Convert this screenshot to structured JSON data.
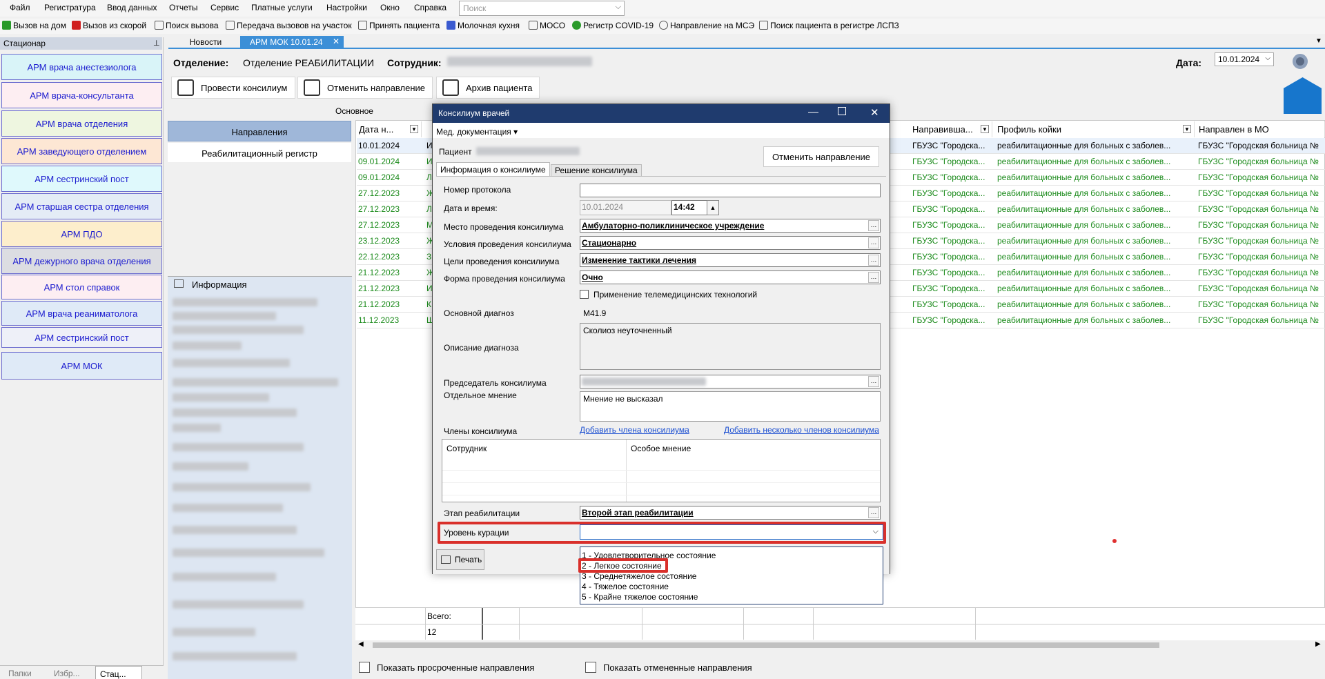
{
  "menu": [
    "Файл",
    "Регистратура",
    "Ввод данных",
    "Отчеты",
    "Сервис",
    "Платные услуги",
    "Настройки",
    "Окно",
    "Справка"
  ],
  "search": {
    "placeholder": "Поиск"
  },
  "toolbar": [
    "Вызов на дом",
    "Вызов из скорой",
    "Поиск вызова",
    "Передача вызовов на участок",
    "Принять пациента",
    "Молочная кухня",
    "МОСО",
    "Регистр COVID-19",
    "Направление на МСЭ",
    "Поиск пациента в регистре ЛСПЗ"
  ],
  "left_panel": {
    "title": "Стационар",
    "items": [
      "АРМ врача анестезиолога",
      "АРМ врача-консультанта",
      "АРМ врача отделения",
      "АРМ заведующего отделением",
      "АРМ сестринский пост",
      "АРМ старшая сестра отделения",
      "АРМ ПДО",
      "АРМ дежурного врача отделения",
      "АРМ стол справок",
      "АРМ врача реаниматолога",
      "АРМ сестринский пост",
      "АРМ МОК"
    ],
    "bottom_tabs": [
      "Папки",
      "Избр...",
      "Стац..."
    ]
  },
  "tabs": {
    "news": "Новости",
    "arm": "АРМ МОК 10.01.24",
    "close": "✕"
  },
  "header": {
    "dept_label": "Отделение:",
    "dept_value": "Отделение РЕАБИЛИТАЦИИ",
    "employee_label": "Сотрудник:",
    "date_label": "Дата:",
    "date_value": "10.01.2024",
    "btn_consilium": "Провести консилиум",
    "btn_cancel": "Отменить направление",
    "btn_archive": "Архив пациента",
    "group_label": "Основное"
  },
  "nav": {
    "directions": "Направления",
    "rehab_register": "Реабилитационный регистр",
    "info": "Информация"
  },
  "grid": {
    "columns": [
      "Дата н...",
      "Направивша...",
      "Профиль койки",
      "Направлен в МО"
    ],
    "rows": [
      {
        "date": "10.01.2024",
        "letter": "И",
        "sender": "ГБУЗС \"Городска...",
        "profile": "реабилитационные для больных с заболев...",
        "mo": "ГБУЗС \"Городская больница №"
      },
      {
        "date": "09.01.2024",
        "letter": "И",
        "sender": "ГБУЗС \"Городска...",
        "profile": "реабилитационные для больных с заболев...",
        "mo": "ГБУЗС \"Городская больница №"
      },
      {
        "date": "09.01.2024",
        "letter": "Л",
        "sender": "ГБУЗС \"Городска...",
        "profile": "реабилитационные для больных с заболев...",
        "mo": "ГБУЗС \"Городская больница №"
      },
      {
        "date": "27.12.2023",
        "letter": "Ж",
        "sender": "ГБУЗС \"Городска...",
        "profile": "реабилитационные для больных с заболев...",
        "mo": "ГБУЗС \"Городская больница №"
      },
      {
        "date": "27.12.2023",
        "letter": "Л",
        "sender": "ГБУЗС \"Городска...",
        "profile": "реабилитационные для больных с заболев...",
        "mo": "ГБУЗС \"Городская больница №"
      },
      {
        "date": "27.12.2023",
        "letter": "М",
        "sender": "ГБУЗС \"Городска...",
        "profile": "реабилитационные для больных с заболев...",
        "mo": "ГБУЗС \"Городская больница №"
      },
      {
        "date": "23.12.2023",
        "letter": "Ж",
        "sender": "ГБУЗС \"Городска...",
        "profile": "реабилитационные для больных с заболев...",
        "mo": "ГБУЗС \"Городская больница №"
      },
      {
        "date": "22.12.2023",
        "letter": "З",
        "sender": "ГБУЗС \"Городска...",
        "profile": "реабилитационные для больных с заболев...",
        "mo": "ГБУЗС \"Городская больница №"
      },
      {
        "date": "21.12.2023",
        "letter": "Ж",
        "sender": "ГБУЗС \"Городска...",
        "profile": "реабилитационные для больных с заболев...",
        "mo": "ГБУЗС \"Городская больница №"
      },
      {
        "date": "21.12.2023",
        "letter": "И",
        "sender": "ГБУЗС \"Городска...",
        "profile": "реабилитационные для больных с заболев...",
        "mo": "ГБУЗС \"Городская больница №"
      },
      {
        "date": "21.12.2023",
        "letter": "К",
        "sender": "ГБУЗС \"Городска...",
        "profile": "реабилитационные для больных с заболев...",
        "mo": "ГБУЗС \"Городская больница №"
      },
      {
        "date": "11.12.2023",
        "letter": "Ш",
        "sender": "ГБУЗС \"Городска...",
        "profile": "реабилитационные для больных с заболев...",
        "mo": "ГБУЗС \"Городская больница №"
      }
    ],
    "total_label": "Всего:",
    "total_value": "12"
  },
  "bottom_checks": {
    "overdue": "Показать просроченные направления",
    "cancelled": "Показать отмененные направления"
  },
  "dialog": {
    "title": "Консилиум врачей",
    "menu": "Мед. документация ▾",
    "patient_label": "Пациент",
    "cancel_btn": "Отменить направление",
    "tab_info": "Информация о консилиуме",
    "tab_decision": "Решение консилиума",
    "protocol_label": "Номер протокола",
    "datetime_label": "Дата и время:",
    "date_value": "10.01.2024",
    "time_value": "14:42",
    "place_label": "Место проведения консилиума",
    "place_value": "Амбулаторно-поликлиническое учреждение",
    "conditions_label": "Условия проведения консилиума",
    "conditions_value": "Стационарно",
    "goals_label": "Цели проведения консилиума",
    "goals_value": "Изменение тактики лечения",
    "form_label": "Форма проведения консилиума",
    "form_value": "Очно",
    "telemed_label": "Применение телемедицинских технологий",
    "main_diag_label": "Основной диагноз",
    "main_diag_value": "M41.9",
    "diag_desc_label": "Описание диагноза",
    "diag_desc_value": "Сколиоз неуточненный",
    "chair_label": "Председатель консилиума",
    "opinion_label": "Отдельное мнение",
    "opinion_value": "Мнение не высказал",
    "members_label": "Члены консилиума",
    "add_member": "Добавить члена консилиума",
    "add_members": "Добавить несколько членов консилиума",
    "col_employee": "Сотрудник",
    "col_opinion": "Особое мнение",
    "rehab_stage_label": "Этап реабилитации",
    "rehab_stage_value": "Второй этап реабилитации",
    "curation_label": "Уровень курации",
    "print_btn": "Печать",
    "options": [
      "1 - Удовлетворительное состояние",
      "2 - Легкое состояние",
      "3 - Среднетяжелое состояние",
      "4 - Тяжелое состояние",
      "5 - Крайне тяжелое состояние"
    ]
  },
  "colors": {
    "accent": "#3c8fd7",
    "dialog_title": "#1f3b6e",
    "highlight": "#d9302b",
    "row_text": "#1a8a1a"
  }
}
